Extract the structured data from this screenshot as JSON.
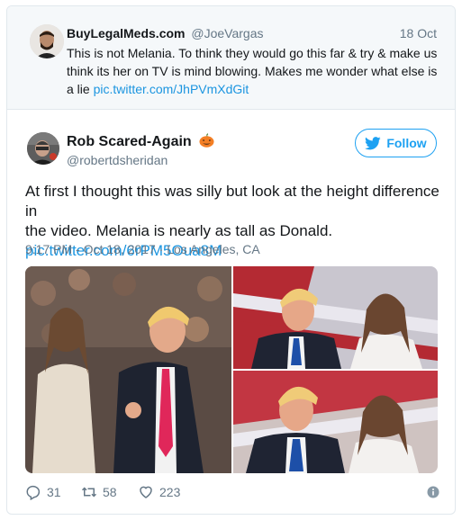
{
  "quoted_tweet": {
    "name": "BuyLegalMeds.com",
    "handle": "@JoeVargas",
    "date": "18 Oct",
    "text": "This is not Melania. To think they would go this far & try & make us think its her on TV is mind blowing. Makes me wonder what else is a lie ",
    "link": "pic.twitter.com/JhPVmXdGit"
  },
  "tweet": {
    "name": "Rob Scared-Again",
    "emoji_icon": "pumpkin-icon",
    "handle": "@robertdsheridan",
    "follow_label": "Follow",
    "text_line1": "At first I thought this was silly but look at the height difference in",
    "text_line2": "the video. Melania is nearly as tall as Donald.",
    "link": "pic.twitter.com/6rPM5Oua8M",
    "timestamp": "9:17 PM - Oct 18, 2017",
    "location": "Los Angeles, CA"
  },
  "stats": {
    "replies": "31",
    "retweets": "58",
    "likes": "223"
  },
  "colors": {
    "accent": "#1da1f2",
    "link": "#1b95e0",
    "muted": "#657786",
    "quote_bg": "#f5f8fa"
  }
}
